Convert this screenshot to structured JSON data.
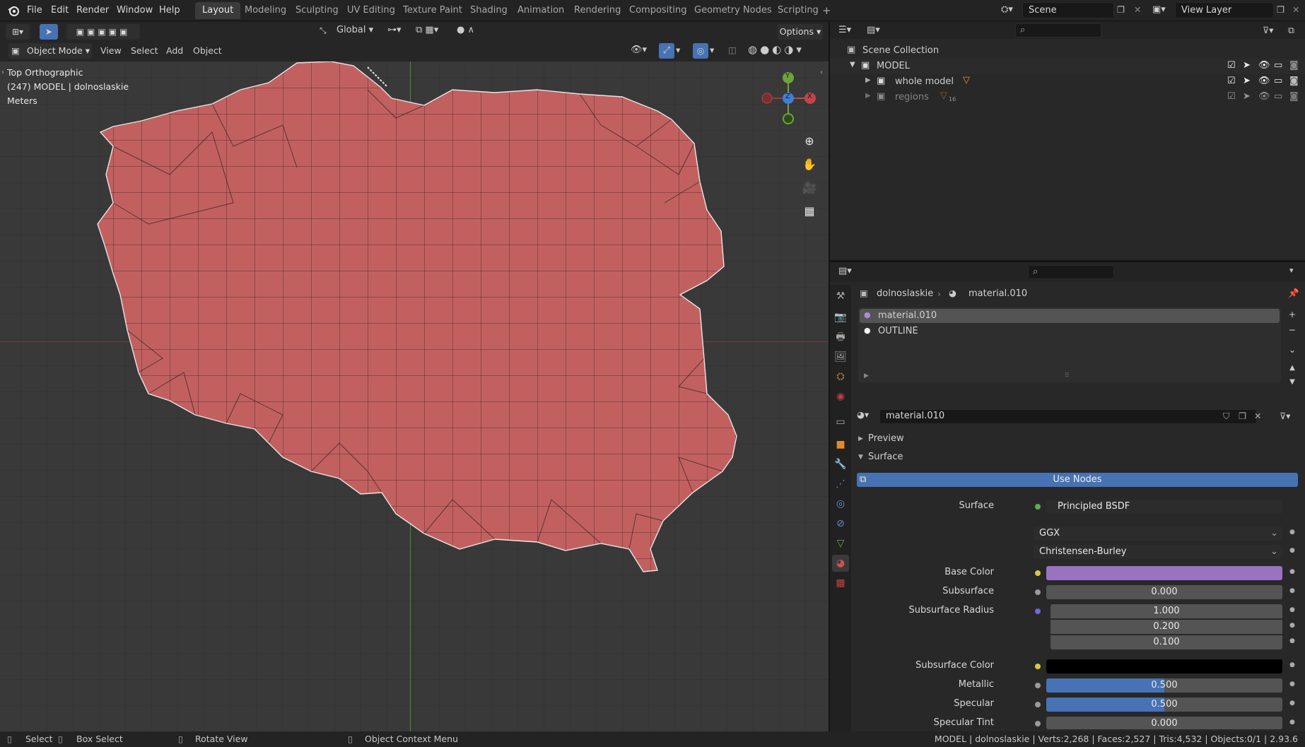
{
  "menu": {
    "app_icon": "blender-logo-icon",
    "items": [
      "File",
      "Edit",
      "Render",
      "Window",
      "Help"
    ]
  },
  "workspaces": [
    "Layout",
    "Modeling",
    "Sculpting",
    "UV Editing",
    "Texture Paint",
    "Shading",
    "Animation",
    "Rendering",
    "Compositing",
    "Geometry Nodes",
    "Scripting"
  ],
  "active_workspace": "Layout",
  "scene": {
    "name": "Scene",
    "view_layer": "View Layer"
  },
  "toolbar": {
    "orientation": "Global",
    "options": "Options"
  },
  "viewport": {
    "mode": "Object Mode",
    "menus": [
      "View",
      "Select",
      "Add",
      "Object"
    ],
    "view_name": "Top Orthographic",
    "object_info": "(247) MODEL | dolnoslaskie",
    "units": "Meters",
    "gizmo": {
      "x": "X",
      "y": "Y",
      "z": "Z"
    },
    "mesh_color": "#c26060"
  },
  "outliner": {
    "root": "Scene Collection",
    "collection": "MODEL",
    "children": [
      {
        "name": "whole model",
        "badge": ""
      },
      {
        "name": "regions",
        "badge": "16"
      }
    ]
  },
  "properties": {
    "breadcrumb": {
      "object": "dolnoslaskie",
      "material": "material.010"
    },
    "slots": [
      {
        "name": "material.010",
        "selected": true
      },
      {
        "name": "OUTLINE",
        "selected": false
      }
    ],
    "material_name": "material.010",
    "panels": {
      "preview": "Preview",
      "surface": "Surface"
    },
    "use_nodes": "Use Nodes",
    "surface_label": "Surface",
    "surface_shader": "Principled BSDF",
    "distribution": "GGX",
    "subsurface_method": "Christensen-Burley",
    "rows": [
      {
        "label": "Base Color",
        "type": "color",
        "color": "#9a72c2"
      },
      {
        "label": "Subsurface",
        "value": "0.000",
        "fill": 0
      },
      {
        "label": "Subsurface Radius",
        "values": [
          "1.000",
          "0.200",
          "0.100"
        ]
      },
      {
        "label": "Subsurface Color",
        "type": "color",
        "color": "#000000"
      },
      {
        "label": "Metallic",
        "value": "0.500",
        "fill": 0.5
      },
      {
        "label": "Specular",
        "value": "0.500",
        "fill": 0.5
      },
      {
        "label": "Specular Tint",
        "value": "0.000",
        "fill": 0
      }
    ]
  },
  "status": {
    "items": [
      "Select",
      "Box Select",
      "Rotate View",
      "Object Context Menu"
    ],
    "info": "MODEL | dolnoslaskie | Verts:2,268 | Faces:2,527 | Tris:4,532 | Objects:0/1 | 2.93.6"
  }
}
